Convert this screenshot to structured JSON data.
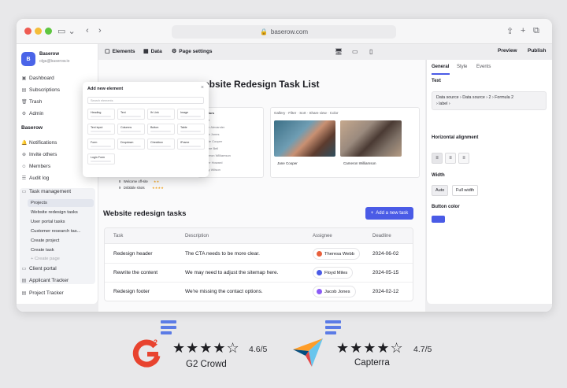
{
  "browser": {
    "url": "baserow.com",
    "share_icon": "share-icon",
    "new_tab_icon": "plus-icon",
    "tabs_icon": "tabs-icon"
  },
  "sidebar": {
    "workspace_initial": "B",
    "workspace_name": "Baserow",
    "workspace_email": "olga@baserow.io",
    "top_items": [
      {
        "label": "Dashboard",
        "icon": "dashboard-icon"
      },
      {
        "label": "Subscriptions",
        "icon": "subscriptions-icon"
      },
      {
        "label": "Trash",
        "icon": "trash-icon"
      },
      {
        "label": "Admin",
        "icon": "admin-icon"
      }
    ],
    "section_title": "Baserow",
    "section_items": [
      {
        "label": "Notifications",
        "icon": "bell-icon"
      },
      {
        "label": "Invite others",
        "icon": "invite-icon"
      },
      {
        "label": "Members",
        "icon": "members-icon"
      },
      {
        "label": "Audit log",
        "icon": "audit-icon"
      }
    ],
    "app_title": "Task management",
    "app_pages": [
      {
        "label": "Projects",
        "active": true
      },
      {
        "label": "Website redesign tasks"
      },
      {
        "label": "User portal tasks"
      },
      {
        "label": "Customer research tas..."
      },
      {
        "label": "Create project"
      },
      {
        "label": "Create task"
      },
      {
        "label": "+ Create page",
        "muted": true
      }
    ],
    "other_apps": [
      {
        "label": "Client portal"
      },
      {
        "label": "Applicant Tracker"
      },
      {
        "label": "Project Tracker"
      }
    ]
  },
  "toolbar": {
    "elements_label": "Elements",
    "data_label": "Data",
    "page_settings_label": "Page settings",
    "preview_label": "Preview",
    "publish_label": "Publish"
  },
  "canvas": {
    "page_title": "ebsite Redesign Task List",
    "gallery": {
      "header": "Gallery  ·  Filter  ·  Sort  ·  Share view  ·  Color",
      "cards": [
        {
          "name": "Jane Cooper"
        },
        {
          "name": "Cameron Williamson"
        }
      ]
    },
    "mini_table_header": "2 Colors",
    "mini_table_rows": [
      "Client",
      "Leslie Alexander",
      "Jacob Jones",
      "Bessie Cooper",
      "Jerome Bell",
      "Cameron Williamson",
      "Esther Howard",
      "Jenny Wilson"
    ],
    "left_rows": [
      {
        "num": "7",
        "name": "Website refresh",
        "stars": "★★★★"
      },
      {
        "num": "8",
        "name": "Welcome off-site",
        "stars": "★★"
      },
      {
        "num": "9",
        "name": "Dribbble shots",
        "stars": "★★★★"
      }
    ],
    "tasks_title": "Website redesign tasks",
    "add_button": "Add a new task",
    "columns": [
      "Task",
      "Description",
      "Assignee",
      "Deadline"
    ],
    "rows": [
      {
        "task": "Redesign header",
        "description": "The CTA needs to be more clear.",
        "assignee": "Theresa Webb",
        "color": "#e8603c",
        "deadline": "2024-06-02"
      },
      {
        "task": "Rewrite the content",
        "description": "We may need to adjust the sitemap here.",
        "assignee": "Floyd Miles",
        "color": "#4a5be6",
        "deadline": "2024-05-15"
      },
      {
        "task": "Redesign footer",
        "description": "We're missing the contact options.",
        "assignee": "Jacob Jones",
        "color": "#8b5cf6",
        "deadline": "2024-02-12"
      }
    ]
  },
  "add_element_popup": {
    "title": "Add new element",
    "search_placeholder": "Search elements",
    "elements": [
      "Heading",
      "Text",
      "Ifr Link",
      "Image",
      "Text input",
      "Columns",
      "Button",
      "Table",
      "Form",
      "Dropdown",
      "Checkbox",
      "IFrame",
      "Login Form"
    ]
  },
  "right_panel": {
    "tabs": [
      "General",
      "Style",
      "Events"
    ],
    "text_label": "Text",
    "formula_line1": "Data source  ›  Data source  ›  2  ›  Formula 2",
    "formula_line2": "›  label  ›",
    "alignment_label": "Horizontal alignment",
    "width_label": "Width",
    "width_options": [
      "Auto",
      "Full width"
    ],
    "button_color_label": "Button color",
    "button_color": "#4a5be6"
  },
  "ratings": [
    {
      "source": "G2 Crowd",
      "score": "4.6/5",
      "stars": "★★★★☆"
    },
    {
      "source": "Capterra",
      "score": "4.7/5",
      "stars": "★★★★☆"
    }
  ]
}
